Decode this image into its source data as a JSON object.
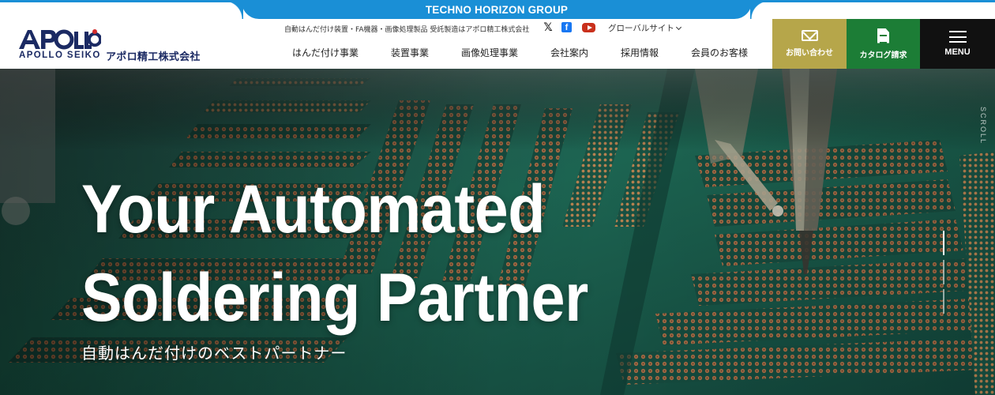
{
  "group_bar": {
    "label": "TECHNO HORIZON GROUP"
  },
  "header": {
    "logo_mark": "APOLLO",
    "logo_en": "APOLLO SEIKO",
    "logo_jp": "アポロ精工株式会社",
    "tagline": "自動はんだ付け装置・FA機器・画像処理製品 受託製造はアポロ精工株式会社",
    "social": [
      {
        "name": "x-icon",
        "glyph": "𝕏"
      },
      {
        "name": "facebook-icon",
        "glyph": "f"
      },
      {
        "name": "youtube-icon",
        "glyph": ""
      }
    ],
    "global_site": "グローバルサイト"
  },
  "nav": {
    "items": [
      {
        "label": "はんだ付け事業"
      },
      {
        "label": "装置事業"
      },
      {
        "label": "画像処理事業"
      },
      {
        "label": "会社案内"
      },
      {
        "label": "採用情報"
      },
      {
        "label": "会員のお客様"
      }
    ]
  },
  "buttons": {
    "contact": "お問い合わせ",
    "catalog": "カタログ請求",
    "menu": "MENU"
  },
  "hero": {
    "title_line1": "Your Automated",
    "title_line2": "Soldering Partner",
    "subtitle": "自動はんだ付けのベストパートナー",
    "scroll_label": "SCROLL",
    "slides_total": 3,
    "slide_active": 1
  },
  "colors": {
    "group_blue": "#1a8fd6",
    "brand_navy": "#1b2a63",
    "contact_gold": "#b6a64a",
    "catalog_green": "#1c7d36",
    "menu_black": "#111111"
  }
}
